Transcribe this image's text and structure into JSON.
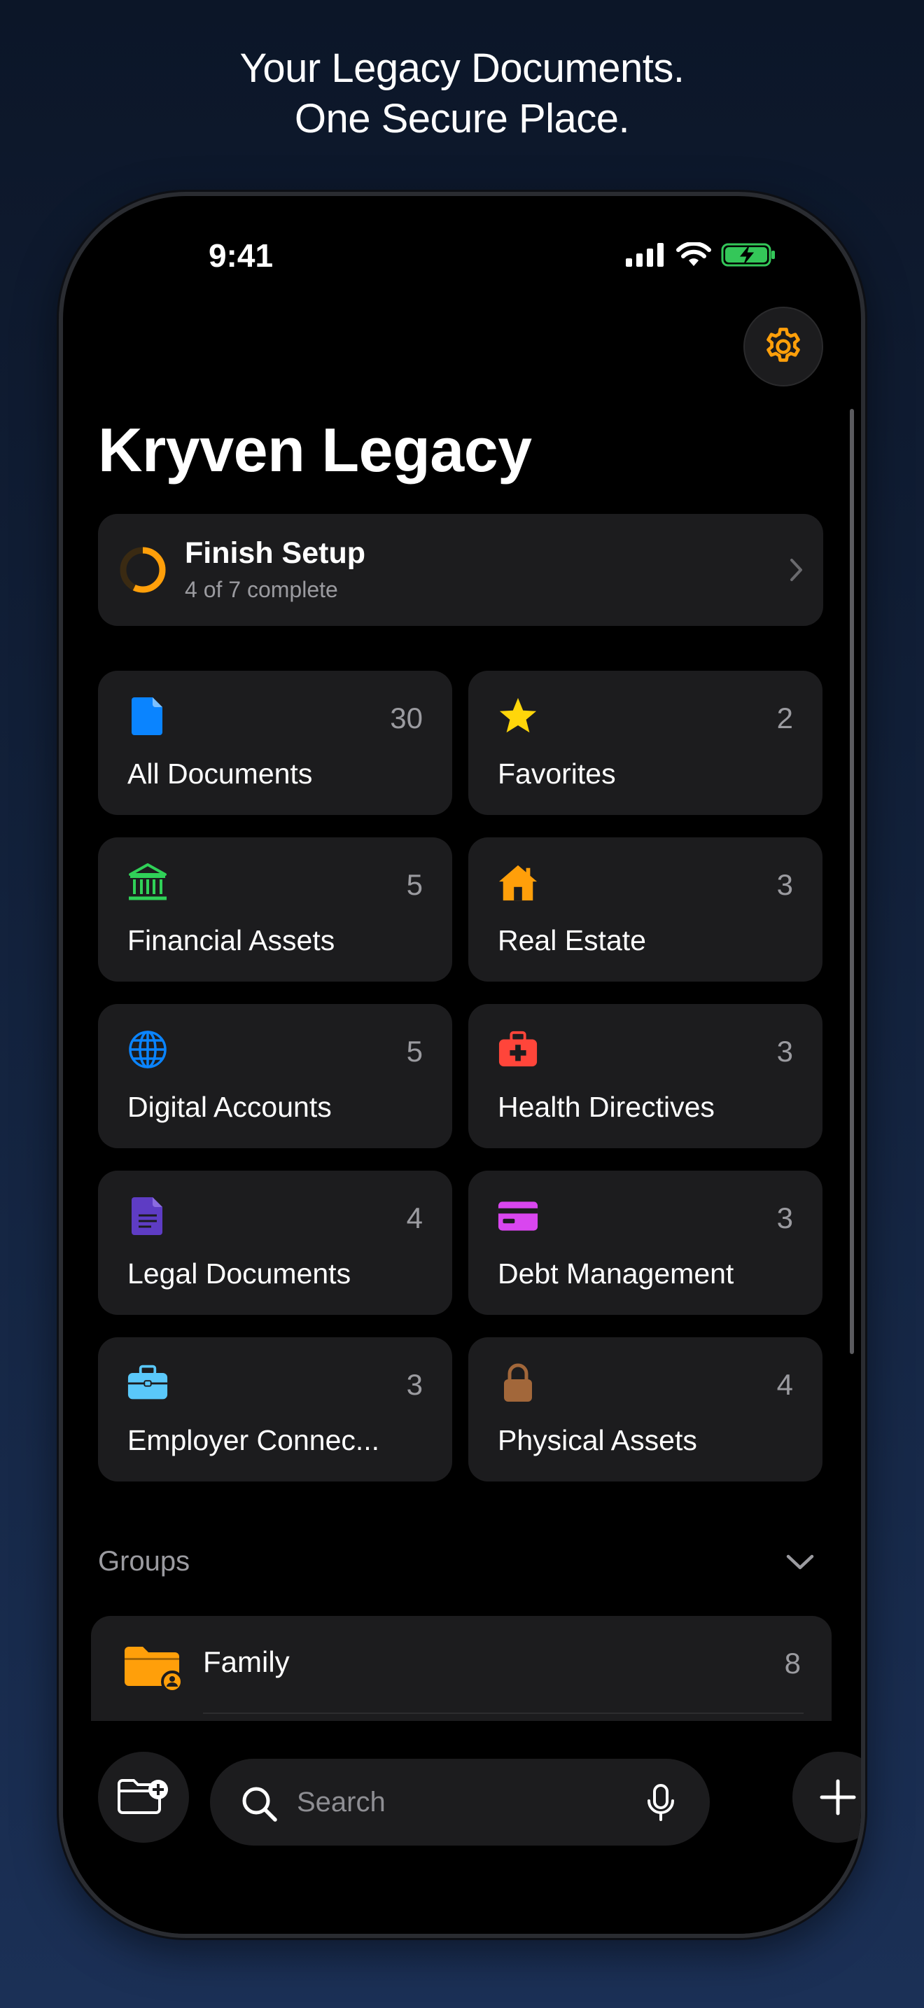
{
  "headline": {
    "line1": "Your Legacy Documents.",
    "line2": "One Secure Place."
  },
  "status_bar": {
    "time": "9:41",
    "icons": [
      "cellular-signal-icon",
      "wifi-icon",
      "battery-charging-icon"
    ]
  },
  "header": {
    "settings_icon": "gear-icon",
    "title": "Kryven Legacy"
  },
  "setup": {
    "title": "Finish Setup",
    "subtitle": "4 of 7 complete",
    "progress": 0.571
  },
  "categories": [
    {
      "label": "All Documents",
      "count": "30",
      "icon": "document-icon",
      "color": "#0a84ff"
    },
    {
      "label": "Favorites",
      "count": "2",
      "icon": "star-icon",
      "color": "#ffd60a"
    },
    {
      "label": "Financial Assets",
      "count": "5",
      "icon": "bank-icon",
      "color": "#30d158"
    },
    {
      "label": "Real Estate",
      "count": "3",
      "icon": "house-icon",
      "color": "#ff9f0a"
    },
    {
      "label": "Digital Accounts",
      "count": "5",
      "icon": "globe-icon",
      "color": "#0a84ff"
    },
    {
      "label": "Health Directives",
      "count": "3",
      "icon": "medical-kit-icon",
      "color": "#ff453a"
    },
    {
      "label": "Legal Documents",
      "count": "4",
      "icon": "legal-document-icon",
      "color": "#5e3cc4"
    },
    {
      "label": "Debt Management",
      "count": "3",
      "icon": "credit-card-icon",
      "color": "#d946ef"
    },
    {
      "label": "Employer Connec...",
      "count": "3",
      "icon": "briefcase-icon",
      "color": "#5ac8fa"
    },
    {
      "label": "Physical Assets",
      "count": "4",
      "icon": "lock-icon",
      "color": "#a2673a"
    }
  ],
  "groups": {
    "label": "Groups",
    "items": [
      {
        "label": "Family",
        "count": "8",
        "icon": "folder-person-icon",
        "color": "#ff9f0a"
      }
    ]
  },
  "bottom_bar": {
    "new_folder_icon": "folder-add-icon",
    "search_placeholder": "Search",
    "mic_icon": "microphone-icon",
    "add_icon": "plus-icon"
  },
  "colors": {
    "accent": "#ff9f0a",
    "card": "#1c1c1e",
    "secondary_text": "#9b9ba0"
  }
}
